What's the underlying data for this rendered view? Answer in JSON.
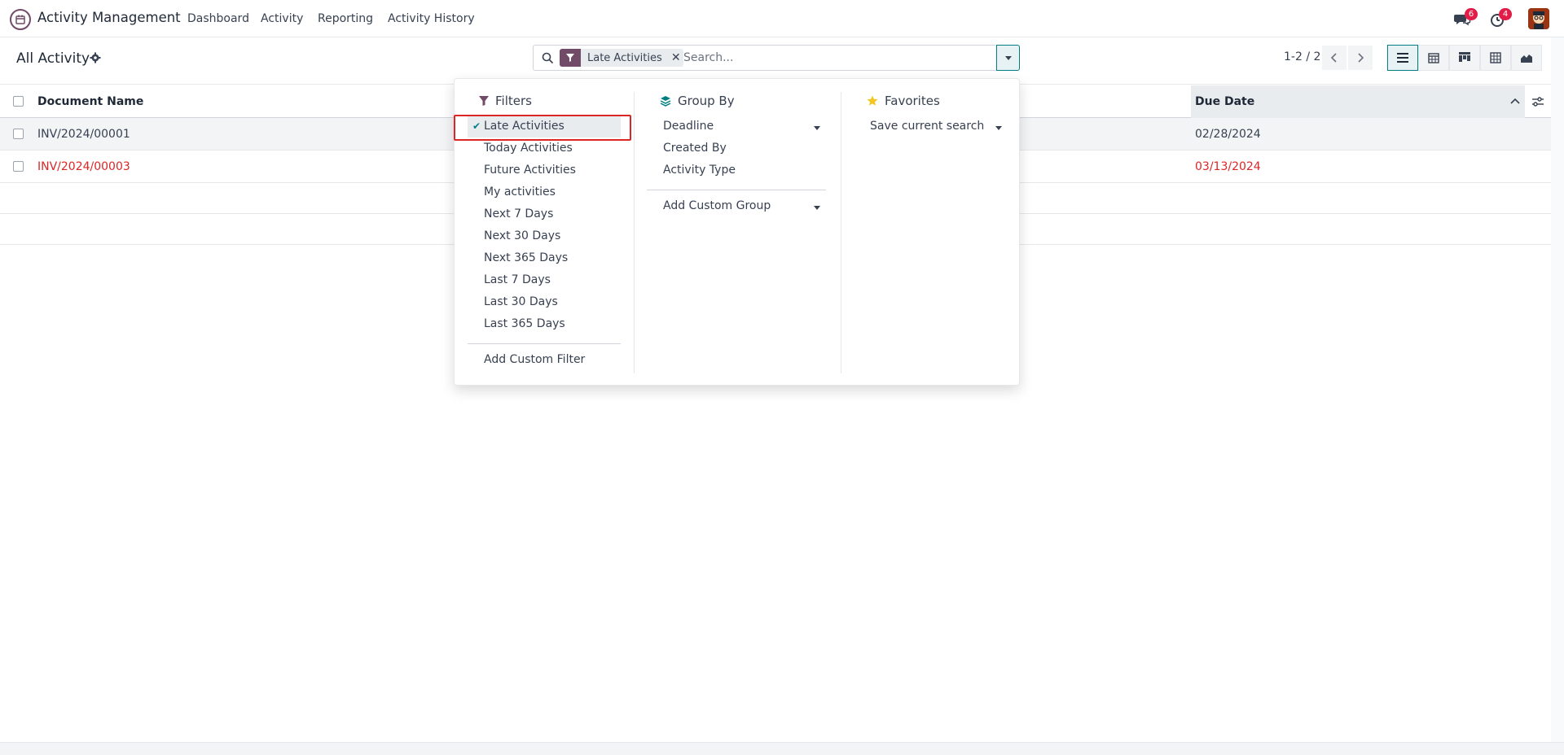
{
  "navbar": {
    "app_name": "Activity Management",
    "menu": [
      "Dashboard",
      "Activity",
      "Reporting",
      "Activity History"
    ],
    "messages_badge": "6",
    "activities_badge": "4"
  },
  "control_panel": {
    "title": "All Activity",
    "search": {
      "facet_label": "Late Activities",
      "placeholder": "Search..."
    },
    "pager": "1-2 / 2"
  },
  "list": {
    "columns": [
      "Document Name",
      "Due Date"
    ],
    "rows": [
      {
        "document": "INV/2024/00001",
        "due_date": "02/28/2024",
        "late": false
      },
      {
        "document": "INV/2024/00003",
        "due_date": "03/13/2024",
        "late": true
      }
    ]
  },
  "search_panel": {
    "filters": {
      "title": "Filters",
      "items": [
        "Late Activities",
        "Today Activities",
        "Future Activities",
        "My activities",
        "Next 7 Days",
        "Next 30 Days",
        "Next 365 Days",
        "Last 7 Days",
        "Last 30 Days",
        "Last 365 Days"
      ],
      "custom": "Add Custom Filter"
    },
    "group_by": {
      "title": "Group By",
      "items": [
        "Deadline",
        "Created By",
        "Activity Type"
      ],
      "custom": "Add Custom Group"
    },
    "favorites": {
      "title": "Favorites",
      "save": "Save current search"
    }
  },
  "colors": {
    "brand": "#714b67",
    "accent": "#017e84",
    "late": "#dc2626"
  }
}
